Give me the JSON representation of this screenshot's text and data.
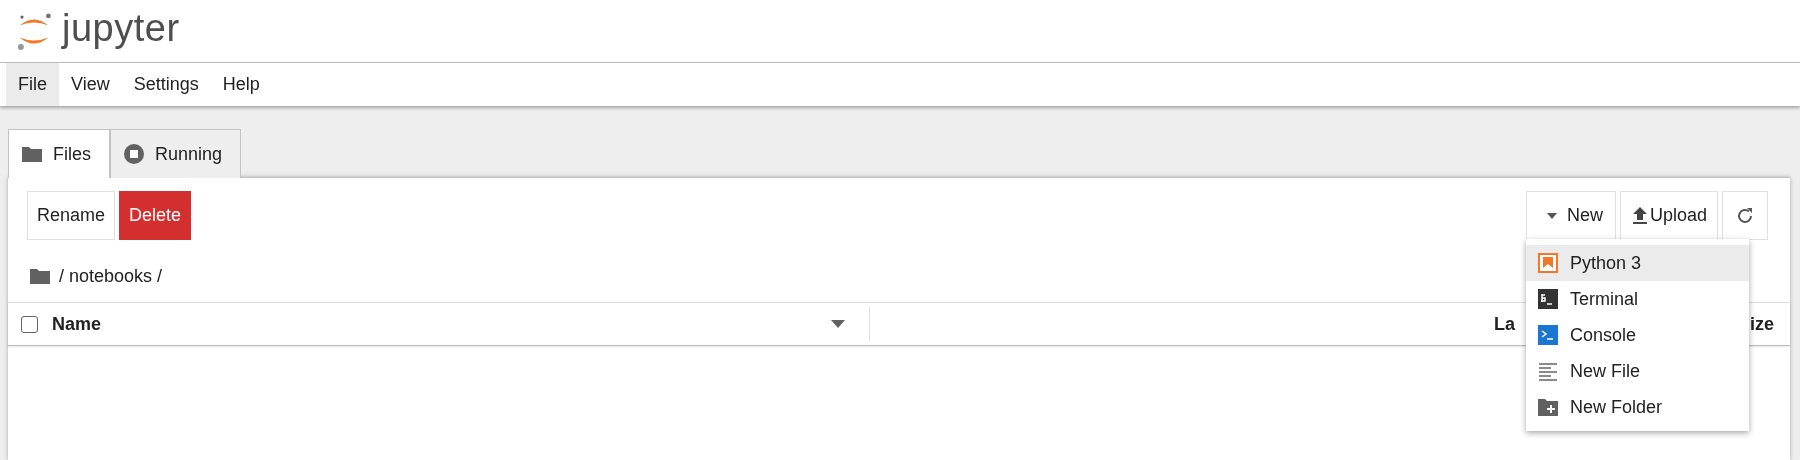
{
  "header": {
    "logo_text": "jupyter"
  },
  "menu_bar": [
    {
      "label": "File",
      "selected": true
    },
    {
      "label": "View",
      "selected": false
    },
    {
      "label": "Settings",
      "selected": false
    },
    {
      "label": "Help",
      "selected": false
    }
  ],
  "tabs": [
    {
      "label": "Files",
      "kind": "folder",
      "selected": true
    },
    {
      "label": "Running",
      "kind": "stop",
      "selected": false
    }
  ],
  "toolbar": {
    "left_buttons": [
      {
        "label": "Rename",
        "kind": "plain"
      },
      {
        "label": "Delete",
        "kind": "danger"
      }
    ],
    "new_button": "New",
    "upload_button": "Upload"
  },
  "breadcrumb": "/ notebooks /",
  "table": {
    "select_all_checked": false,
    "columns": [
      "Name",
      "La",
      "ize"
    ]
  },
  "new_menu": [
    {
      "label": "Python 3",
      "kind": "notebook",
      "selected": true
    },
    {
      "label": "Terminal",
      "kind": "terminal",
      "selected": false
    },
    {
      "label": "Console",
      "kind": "console",
      "selected": false
    },
    {
      "label": "New File",
      "kind": "file",
      "selected": false
    },
    {
      "label": "New Folder",
      "kind": "folder",
      "selected": false
    }
  ]
}
